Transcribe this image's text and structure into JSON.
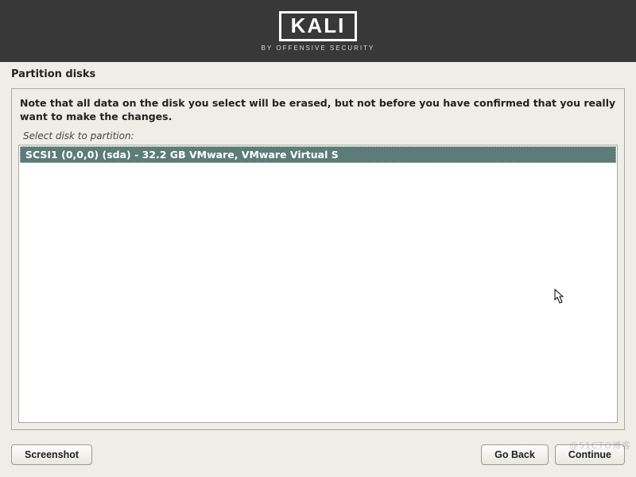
{
  "banner": {
    "logo_text": "KALI",
    "logo_sub": "BY OFFENSIVE SECURITY"
  },
  "page": {
    "title": "Partition disks",
    "warning": "Note that all data on the disk you select will be erased, but not before you have confirmed that you really want to make the changes.",
    "select_label": "Select disk to partition:"
  },
  "disks": [
    {
      "label": "SCSI1 (0,0,0) (sda) - 32.2 GB VMware, VMware Virtual S",
      "selected": true
    }
  ],
  "buttons": {
    "screenshot": "Screenshot",
    "go_back": "Go Back",
    "continue": "Continue"
  },
  "watermark": "@51CTO博客"
}
